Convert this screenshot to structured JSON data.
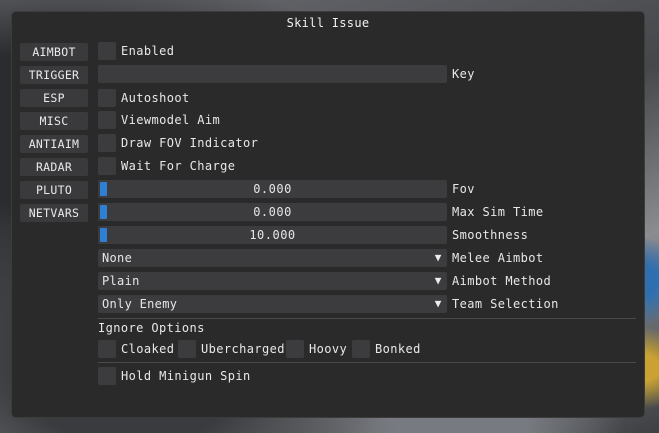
{
  "window": {
    "title": "Skill Issue"
  },
  "sidebar": {
    "items": [
      {
        "label": "AIMBOT"
      },
      {
        "label": "TRIGGER"
      },
      {
        "label": "ESP"
      },
      {
        "label": "MISC"
      },
      {
        "label": "ANTIAIM"
      },
      {
        "label": "RADAR"
      },
      {
        "label": "PLUTO"
      },
      {
        "label": "NETVARS"
      }
    ]
  },
  "aimbot": {
    "enabled": {
      "label": "Enabled",
      "checked": false
    },
    "key": {
      "value": "",
      "label": "Key"
    },
    "autoshoot": {
      "label": "Autoshoot",
      "checked": false
    },
    "viewmodel_aim": {
      "label": "Viewmodel Aim",
      "checked": false
    },
    "draw_fov": {
      "label": "Draw FOV Indicator",
      "checked": false
    },
    "wait_charge": {
      "label": "Wait For Charge",
      "checked": false
    },
    "fov": {
      "value": "0.000",
      "label": "Fov"
    },
    "max_sim_time": {
      "value": "0.000",
      "label": "Max Sim Time"
    },
    "smoothness": {
      "value": "10.000",
      "label": "Smoothness"
    },
    "melee_aimbot": {
      "value": "None",
      "label": "Melee Aimbot"
    },
    "aimbot_method": {
      "value": "Plain",
      "label": "Aimbot Method"
    },
    "team_selection": {
      "value": "Only Enemy",
      "label": "Team Selection"
    },
    "ignore_options": {
      "heading": "Ignore Options",
      "items": [
        {
          "label": "Cloaked",
          "checked": false
        },
        {
          "label": "Ubercharged",
          "checked": false
        },
        {
          "label": "Hoovy",
          "checked": false
        },
        {
          "label": "Bonked",
          "checked": false
        }
      ]
    },
    "hold_minigun": {
      "label": "Hold Minigun Spin",
      "checked": false
    }
  },
  "icons": {
    "combo_arrow": "triangle-down"
  },
  "colors": {
    "accent": "#2f7fd4",
    "window_bg": "#2a2a2b",
    "widget_bg": "#3c3c3e"
  }
}
